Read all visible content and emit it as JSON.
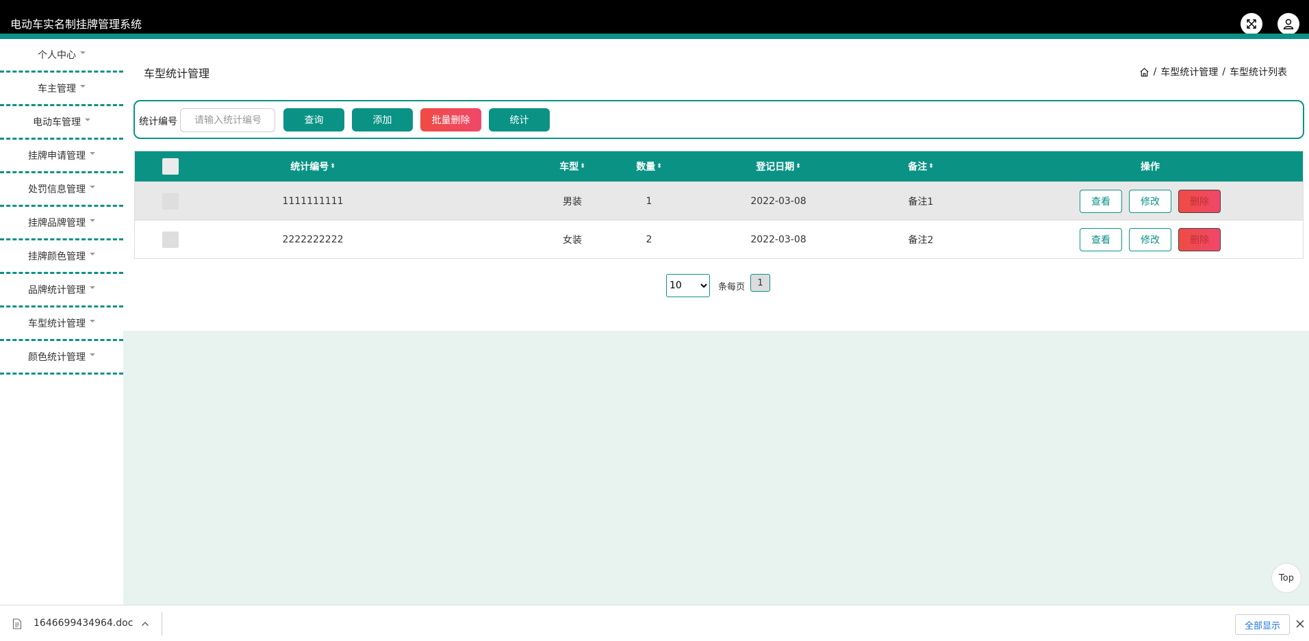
{
  "app": {
    "title": "电动车实名制挂牌管理系统"
  },
  "sidebar": {
    "items": [
      {
        "label": "个人中心"
      },
      {
        "label": "车主管理"
      },
      {
        "label": "电动车管理"
      },
      {
        "label": "挂牌申请管理"
      },
      {
        "label": "处罚信息管理"
      },
      {
        "label": "挂牌品牌管理"
      },
      {
        "label": "挂牌颜色管理"
      },
      {
        "label": "品牌统计管理"
      },
      {
        "label": "车型统计管理"
      },
      {
        "label": "颜色统计管理"
      }
    ]
  },
  "page": {
    "title": "车型统计管理"
  },
  "breadcrumb": {
    "level1": "车型统计管理",
    "level2": "车型统计列表",
    "separator": "/"
  },
  "search": {
    "label": "统计编号",
    "placeholder": "请输入统计编号",
    "query_label": "查询",
    "add_label": "添加",
    "batch_delete_label": "批量删除",
    "stats_label": "统计"
  },
  "table": {
    "headers": {
      "code": "统计编号",
      "type": "车型",
      "count": "数量",
      "date": "登记日期",
      "note": "备注",
      "actions": "操作"
    },
    "sort_glyph": "⬍",
    "rows": [
      {
        "code": "1111111111",
        "type": "男装",
        "count": "1",
        "date": "2022-03-08",
        "note": "备注1"
      },
      {
        "code": "2222222222",
        "type": "女装",
        "count": "2",
        "date": "2022-03-08",
        "note": "备注2"
      }
    ],
    "actions": {
      "view": "查看",
      "edit": "修改",
      "delete": "删除"
    }
  },
  "pagination": {
    "page_size": "10",
    "page_size_options": [
      "10"
    ],
    "per_page_label": "条每页",
    "current_page": "1"
  },
  "top_button": {
    "label": "Top"
  },
  "download_bar": {
    "file_name": "1646699434964.doc",
    "show_all": "全部显示"
  },
  "colors": {
    "accent": "#0a9285",
    "danger": "#f04b43",
    "header_bg": "#000000",
    "content_bg": "#e8f3ef"
  }
}
